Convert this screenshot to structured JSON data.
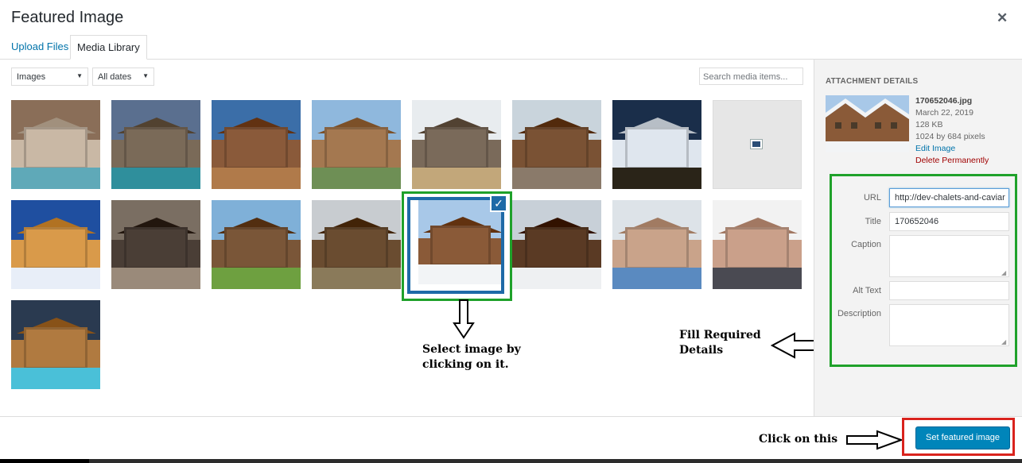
{
  "modal": {
    "title": "Featured Image"
  },
  "tabs": [
    {
      "label": "Upload Files"
    },
    {
      "label": "Media Library"
    }
  ],
  "filters": {
    "type_selected": "Images",
    "date_selected": "All dates"
  },
  "search": {
    "placeholder": "Search media items..."
  },
  "media_grid": {
    "items": [
      {
        "row": 1,
        "col": 1,
        "scene": "interior-living-room",
        "sky": "#8a6e58",
        "body": "#c9b8a5",
        "ground": "#5fa9b8"
      },
      {
        "row": 1,
        "col": 2,
        "scene": "hotel-pool-dusk",
        "sky": "#5a6f8f",
        "body": "#7a6a58",
        "ground": "#2f8f9c"
      },
      {
        "row": 1,
        "col": 3,
        "scene": "chalet-interior-view",
        "sky": "#3b6ea8",
        "body": "#8a5a3a",
        "ground": "#b07a4a"
      },
      {
        "row": 1,
        "col": 4,
        "scene": "chalet-exterior",
        "sky": "#8fb8dd",
        "body": "#a47850",
        "ground": "#6e8f55"
      },
      {
        "row": 1,
        "col": 5,
        "scene": "modern-cabin",
        "sky": "#e8ecef",
        "body": "#7a6a5a",
        "ground": "#c2a77a"
      },
      {
        "row": 1,
        "col": 6,
        "scene": "wooden-chalet",
        "sky": "#c9d4dc",
        "body": "#7a5234",
        "ground": "#8a7a6a"
      },
      {
        "row": 1,
        "col": 7,
        "scene": "mountain-town-night",
        "sky": "#1a2e4a",
        "body": "#dfe6ee",
        "ground": "#2a2418"
      },
      {
        "row": 1,
        "col": 8,
        "scene": "placeholder",
        "sky": "#e6e6e6",
        "body": "#e6e6e6",
        "ground": "#e6e6e6"
      },
      {
        "row": 2,
        "col": 1,
        "scene": "chalet-snow-night",
        "sky": "#1f4fa0",
        "body": "#d99a4a",
        "ground": "#e8eef8"
      },
      {
        "row": 2,
        "col": 2,
        "scene": "fireplace-interior",
        "sky": "#7a6e62",
        "body": "#4a3e36",
        "ground": "#9a8a7a"
      },
      {
        "row": 2,
        "col": 3,
        "scene": "chalet-meadow",
        "sky": "#7fb0d8",
        "body": "#7a5638",
        "ground": "#6ea040"
      },
      {
        "row": 2,
        "col": 4,
        "scene": "old-chalet",
        "sky": "#c8ccd0",
        "body": "#6a4c30",
        "ground": "#8a7a5a"
      },
      {
        "row": 2,
        "col": 5,
        "scene": "snowy-chalet",
        "sky": "#a8c8e8",
        "body": "#8a5a38",
        "ground": "#f2f4f6",
        "selected": true
      },
      {
        "row": 2,
        "col": 6,
        "scene": "chalet-snow-evening",
        "sky": "#c8d0d8",
        "body": "#5a3a24",
        "ground": "#eef0f2"
      },
      {
        "row": 2,
        "col": 7,
        "scene": "portrait-man",
        "sky": "#dde3e8",
        "body": "#c9a38a",
        "ground": "#5a8ac0"
      },
      {
        "row": 2,
        "col": 8,
        "scene": "portrait-woman",
        "sky": "#f2f2f2",
        "body": "#caa08a",
        "ground": "#4a4a52"
      },
      {
        "row": 3,
        "col": 1,
        "scene": "chalet-pool-night",
        "sky": "#2a3a50",
        "body": "#b07a40",
        "ground": "#4ac0d8"
      }
    ]
  },
  "attachment": {
    "heading": "Attachment Details",
    "filename": "170652046.jpg",
    "date": "March 22, 2019",
    "size": "128 KB",
    "dimensions": "1024 by 684 pixels",
    "edit_link": "Edit Image",
    "delete_link": "Delete Permanently",
    "fields": {
      "url_label": "URL",
      "url_value": "http://dev-chalets-and-caviar",
      "title_label": "Title",
      "title_value": "170652046",
      "caption_label": "Caption",
      "caption_value": "",
      "alt_label": "Alt Text",
      "alt_value": "",
      "description_label": "Description",
      "description_value": ""
    }
  },
  "annotations": {
    "select_line1": "Select image by",
    "select_line2": "clicking on it.",
    "fill_line1": "Fill Required",
    "fill_line2": "Details",
    "click_text": "Click on this"
  },
  "footer": {
    "primary_button": "Set featured image"
  },
  "colors": {
    "highlight_green": "#1fa12a",
    "highlight_red": "#d9231d",
    "selection_blue": "#1e6aa7",
    "primary_button": "#0085ba",
    "link": "#0073aa"
  }
}
